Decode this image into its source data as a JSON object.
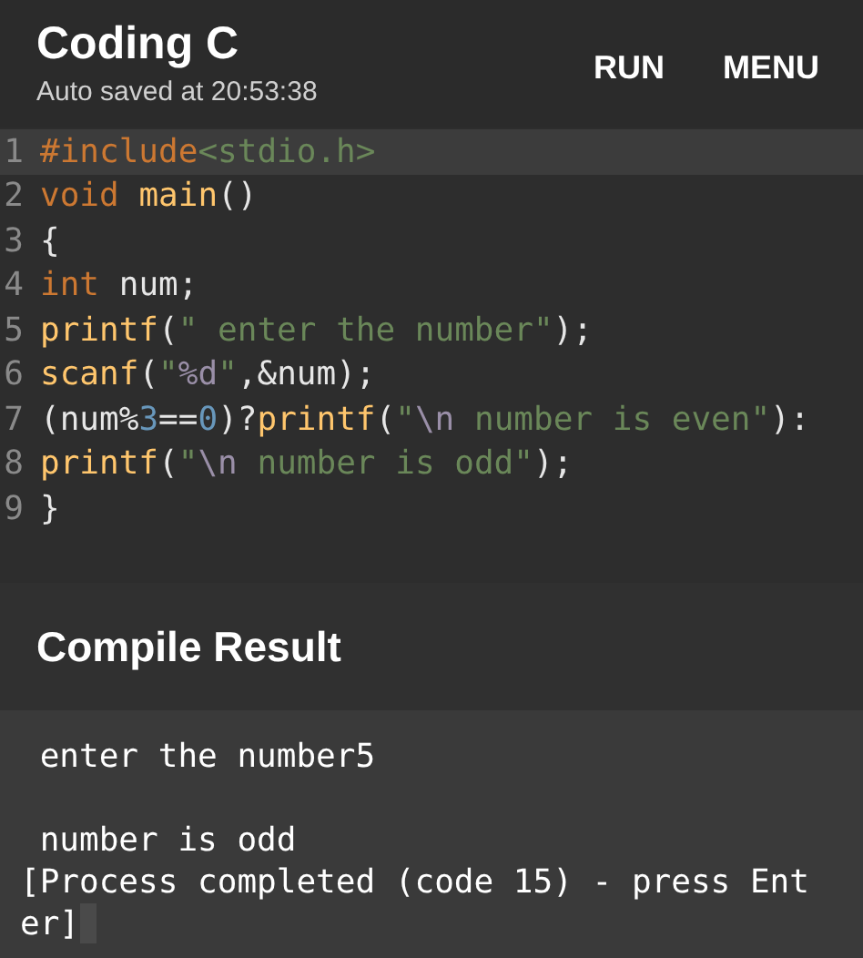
{
  "header": {
    "title": "Coding C",
    "subtitle": "Auto saved at 20:53:38",
    "actions": [
      "RUN",
      "MENU"
    ]
  },
  "editor": {
    "lines": [
      {
        "number": "1",
        "selected": true,
        "tokens": [
          {
            "kind": "keyword",
            "text": "#include"
          },
          {
            "kind": "string",
            "text": "<stdio.h>"
          }
        ]
      },
      {
        "number": "2",
        "selected": false,
        "tokens": [
          {
            "kind": "keyword",
            "text": "void"
          },
          {
            "kind": "function",
            "text": " main"
          },
          {
            "kind": "plain",
            "text": "()"
          }
        ]
      },
      {
        "number": "3",
        "selected": false,
        "tokens": [
          {
            "kind": "plain",
            "text": "{"
          }
        ]
      },
      {
        "number": "4",
        "selected": false,
        "tokens": [
          {
            "kind": "keyword",
            "text": "int"
          },
          {
            "kind": "plain",
            "text": " num;"
          }
        ]
      },
      {
        "number": "5",
        "selected": false,
        "tokens": [
          {
            "kind": "function",
            "text": "printf"
          },
          {
            "kind": "plain",
            "text": "("
          },
          {
            "kind": "string",
            "text": "\" enter the number\""
          },
          {
            "kind": "plain",
            "text": ");"
          }
        ]
      },
      {
        "number": "6",
        "selected": false,
        "tokens": [
          {
            "kind": "function",
            "text": "scanf"
          },
          {
            "kind": "plain",
            "text": "("
          },
          {
            "kind": "string",
            "text": "\""
          },
          {
            "kind": "escape",
            "text": "%d"
          },
          {
            "kind": "string",
            "text": "\""
          },
          {
            "kind": "plain",
            "text": ",&num);"
          }
        ]
      },
      {
        "number": "7",
        "selected": false,
        "tokens": [
          {
            "kind": "plain",
            "text": "(num%"
          },
          {
            "kind": "number",
            "text": "3"
          },
          {
            "kind": "plain",
            "text": "=="
          },
          {
            "kind": "number",
            "text": "0"
          },
          {
            "kind": "plain",
            "text": ")?"
          },
          {
            "kind": "function",
            "text": "printf"
          },
          {
            "kind": "plain",
            "text": "("
          },
          {
            "kind": "string",
            "text": "\""
          },
          {
            "kind": "escape",
            "text": "\\n"
          },
          {
            "kind": "string",
            "text": " number is even\""
          },
          {
            "kind": "plain",
            "text": "):"
          }
        ]
      },
      {
        "number": "8",
        "selected": false,
        "tokens": [
          {
            "kind": "function",
            "text": "printf"
          },
          {
            "kind": "plain",
            "text": "("
          },
          {
            "kind": "string",
            "text": "\""
          },
          {
            "kind": "escape",
            "text": "\\n"
          },
          {
            "kind": "string",
            "text": " number is odd\""
          },
          {
            "kind": "plain",
            "text": ");"
          }
        ]
      },
      {
        "number": "9",
        "selected": false,
        "tokens": [
          {
            "kind": "plain",
            "text": "}"
          }
        ]
      }
    ]
  },
  "compile_result": {
    "title": "Compile Result"
  },
  "terminal": {
    "blocks": [
      [
        " enter the number5"
      ],
      [
        " number is odd",
        "[Process completed (code 15) - press Ent",
        "er]"
      ]
    ]
  }
}
